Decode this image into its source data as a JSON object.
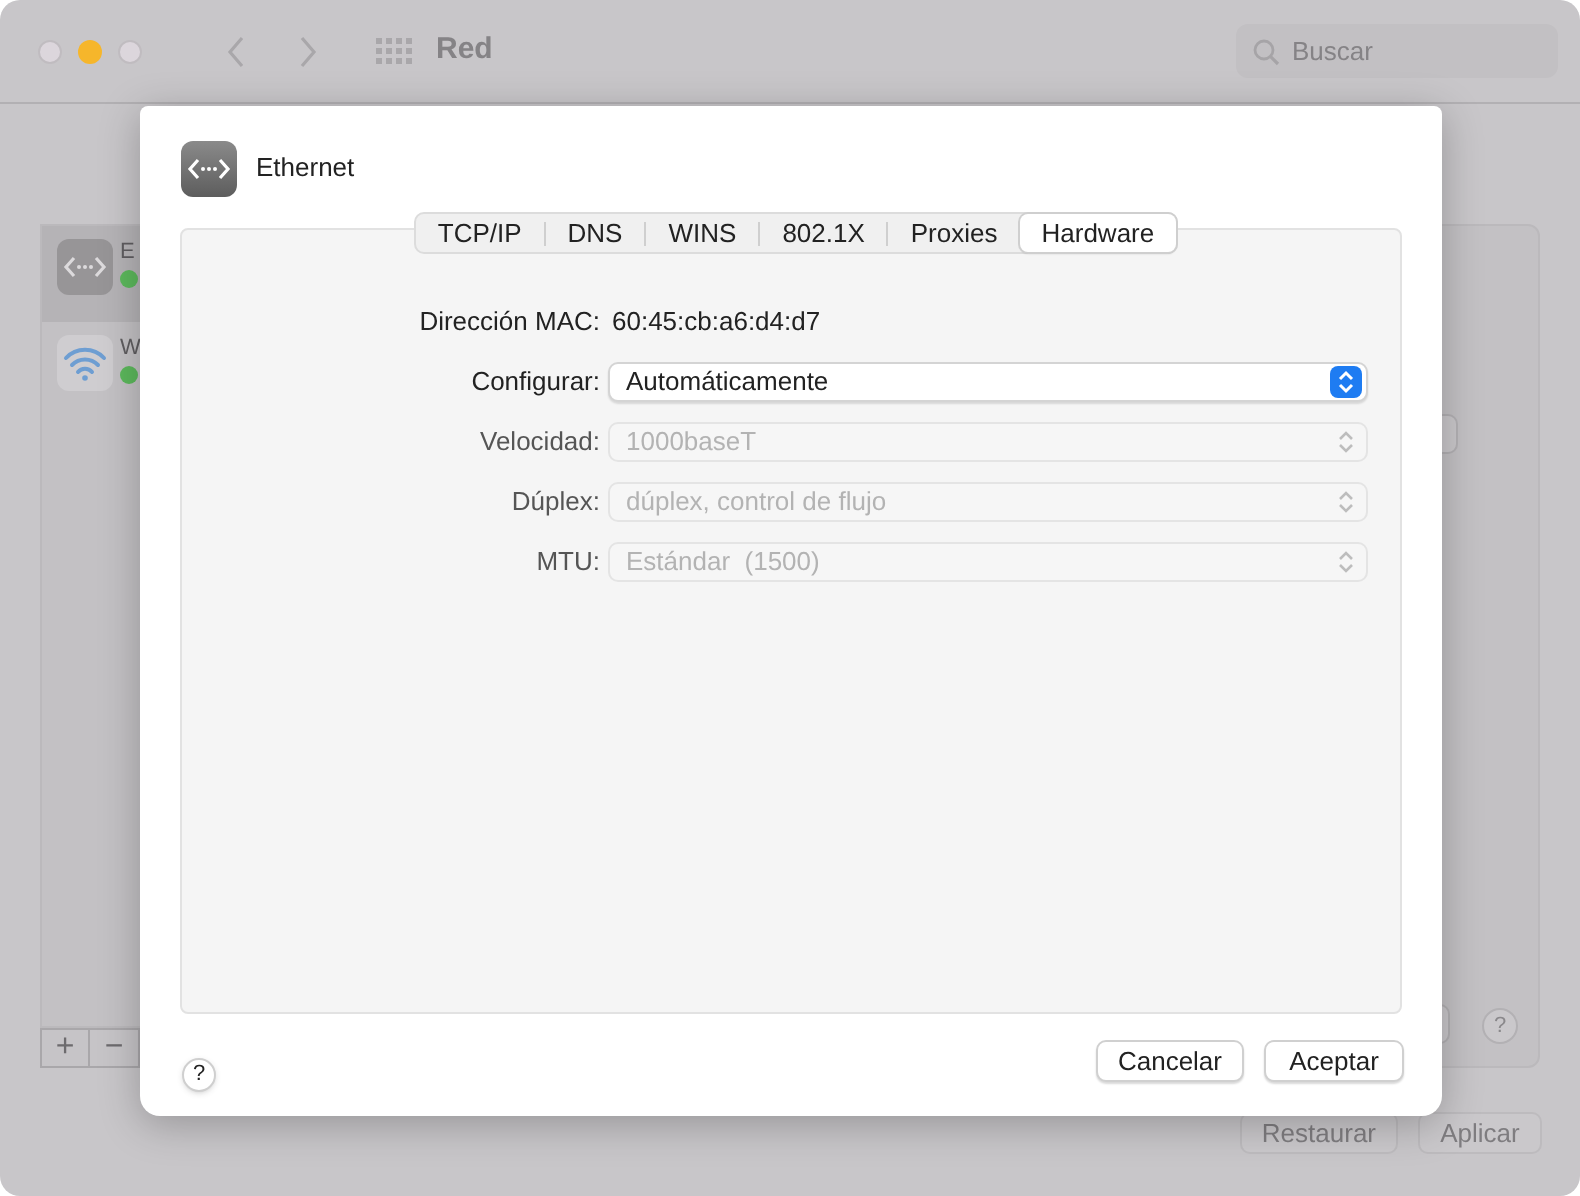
{
  "window": {
    "title": "Red",
    "search": {
      "placeholder": "Buscar"
    }
  },
  "sidebar": {
    "items": [
      {
        "label": "E",
        "kind": "ethernet",
        "selected": true,
        "color": "#5cb85c"
      },
      {
        "label": "W",
        "kind": "wifi",
        "selected": false,
        "color": "#5cb85c"
      }
    ],
    "add_button": "+",
    "remove_button": "−"
  },
  "footer_buttons": [
    {
      "label": "Restaurar"
    },
    {
      "label": "Aplicar"
    }
  ],
  "sheet": {
    "title": "Ethernet",
    "tabs": [
      {
        "label": "TCP/IP",
        "selected": false
      },
      {
        "label": "DNS",
        "selected": false
      },
      {
        "label": "WINS",
        "selected": false
      },
      {
        "label": "802.1X",
        "selected": false
      },
      {
        "label": "Proxies",
        "selected": false
      },
      {
        "label": "Hardware",
        "selected": true
      }
    ],
    "fields": [
      {
        "kind": "text",
        "label": "Dirección MAC:",
        "value": "60:45:cb:a6:d4:d7"
      },
      {
        "kind": "popup",
        "label": "Configurar:",
        "value": "Automáticamente",
        "disabled": false
      },
      {
        "kind": "popup",
        "label": "Velocidad:",
        "value": "1000baseT",
        "disabled": true
      },
      {
        "kind": "popup",
        "label": "Dúplex:",
        "value": "dúplex, control de flujo",
        "disabled": true
      },
      {
        "kind": "popup",
        "label": "MTU:",
        "value": "Estándar  (1500)",
        "disabled": true
      }
    ],
    "help": "?",
    "buttons": [
      {
        "label": "Cancelar"
      },
      {
        "label": "Aceptar"
      }
    ]
  },
  "help": "?"
}
